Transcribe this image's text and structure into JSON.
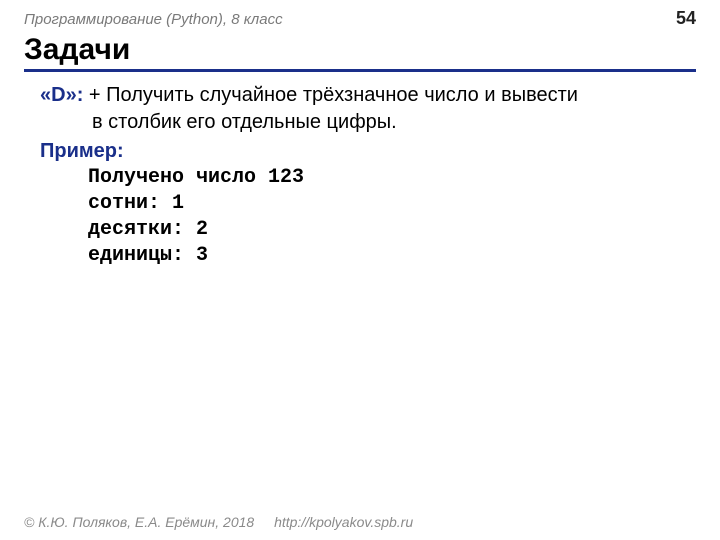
{
  "header": {
    "breadcrumb": "Программирование (Python), 8 класс",
    "page_number": "54"
  },
  "title": "Задачи",
  "task": {
    "label": "«D»:",
    "text_line1": " + Получить случайное трёхзначное число и вывести",
    "text_line2": "в столбик его отдельные цифры."
  },
  "example": {
    "label": "Пример:",
    "lines": [
      "Получено число 123",
      "сотни: 1",
      "десятки: 2",
      "единицы: 3"
    ]
  },
  "footer": {
    "copyright": "© К.Ю. Поляков, Е.А. Ерёмин, 2018",
    "link": "http://kpolyakov.spb.ru"
  }
}
